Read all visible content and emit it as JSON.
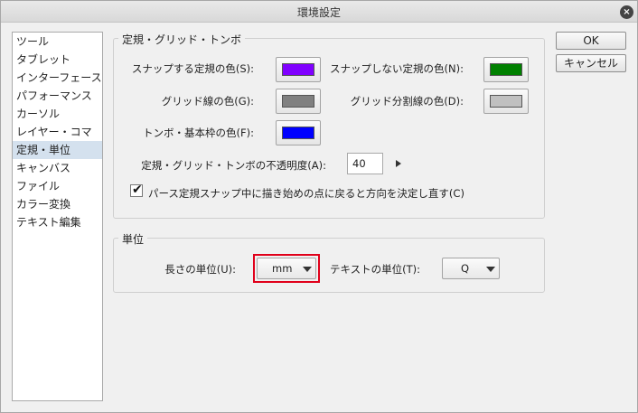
{
  "window": {
    "title": "環境設定",
    "close_icon": "×"
  },
  "sidebar": {
    "items": [
      {
        "label": "ツール",
        "selected": false
      },
      {
        "label": "タブレット",
        "selected": false
      },
      {
        "label": "インターフェース",
        "selected": false
      },
      {
        "label": "パフォーマンス",
        "selected": false
      },
      {
        "label": "カーソル",
        "selected": false
      },
      {
        "label": "レイヤー・コマ",
        "selected": false
      },
      {
        "label": "定規・単位",
        "selected": true
      },
      {
        "label": "キャンバス",
        "selected": false
      },
      {
        "label": "ファイル",
        "selected": false
      },
      {
        "label": "カラー変換",
        "selected": false
      },
      {
        "label": "テキスト編集",
        "selected": false
      }
    ]
  },
  "buttons": {
    "ok": "OK",
    "cancel": "キャンセル"
  },
  "ruler_group": {
    "title": "定規・グリッド・トンボ",
    "snap_color_label": "スナップする定規の色(S):",
    "snap_color": "#8000ff",
    "nosnap_color_label": "スナップしない定規の色(N):",
    "nosnap_color": "#008000",
    "grid_color_label": "グリッド線の色(G):",
    "grid_color": "#808080",
    "grid_div_color_label": "グリッド分割線の色(D):",
    "grid_div_color": "#c0c0c0",
    "crop_color_label": "トンボ・基本枠の色(F):",
    "crop_color": "#0000ff",
    "opacity_label": "定規・グリッド・トンボの不透明度(A):",
    "opacity_value": "40",
    "perspective_checkbox_label": "パース定規スナップ中に描き始めの点に戻ると方向を決定し直す(C)",
    "perspective_checked": true
  },
  "unit_group": {
    "title": "単位",
    "length_unit_label": "長さの単位(U):",
    "length_unit_value": "mm",
    "text_unit_label": "テキストの単位(T):",
    "text_unit_value": "Q"
  },
  "colors": {
    "highlight": "#e0001a"
  }
}
